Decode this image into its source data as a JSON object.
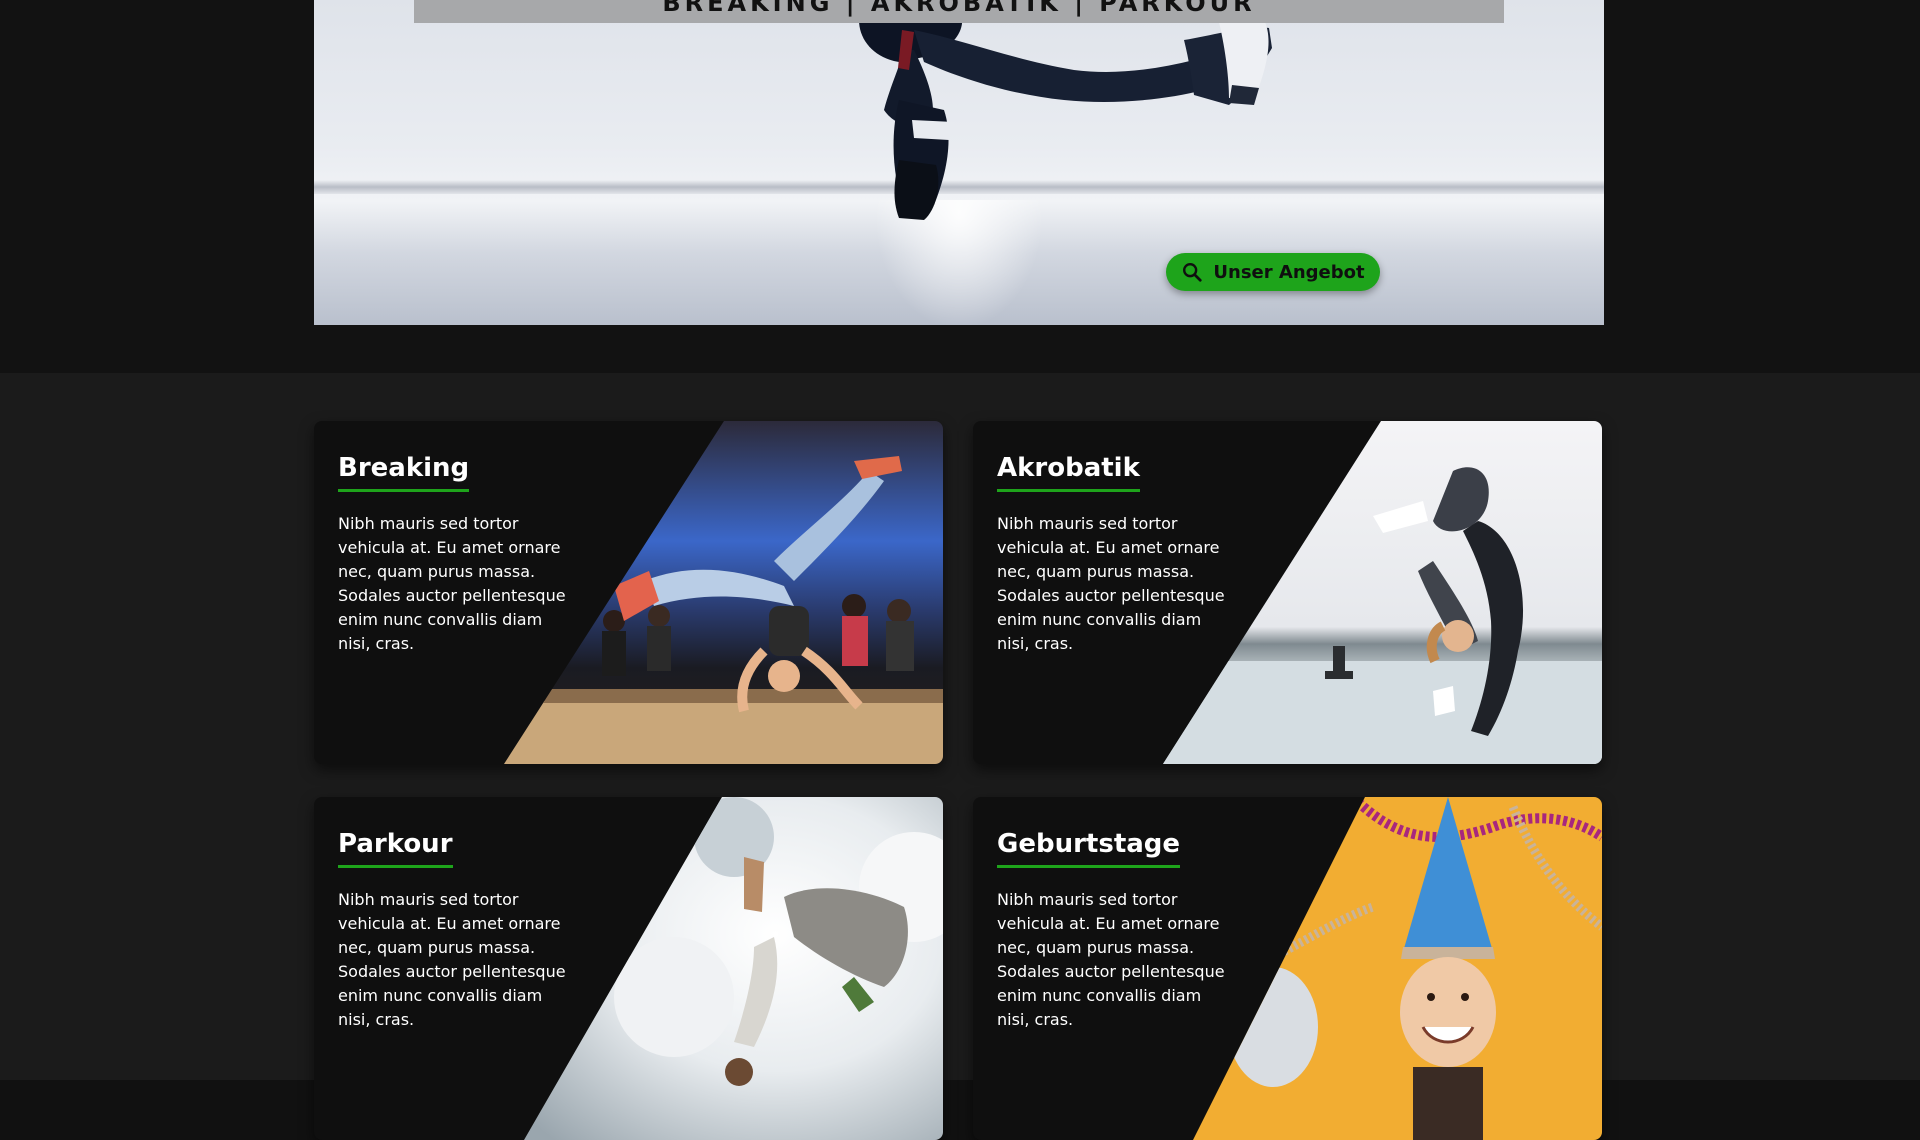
{
  "hero": {
    "banner_text": "BREAKING | AKROBATIK | PARKOUR",
    "cta_label": "Unser Angebot",
    "cta_icon": "search-icon"
  },
  "colors": {
    "accent": "#1ea41b",
    "background": "#121212",
    "section_background": "#1b1b1b",
    "card_background": "#0f0f0f"
  },
  "cards": [
    {
      "title": "Breaking",
      "text": "Nibh mauris sed tortor vehicula at. Eu amet ornare nec, quam purus massa. Sodales auctor pellentesque enim nunc convallis diam nisi, cras.",
      "image": "breakdancer-headspin-photo"
    },
    {
      "title": "Akrobatik",
      "text": "Nibh mauris sed tortor vehicula at. Eu amet ornare nec, quam purus massa. Sodales auctor pellentesque enim nunc convallis diam nisi, cras.",
      "image": "acrobat-backbend-photo"
    },
    {
      "title": "Parkour",
      "text": "Nibh mauris sed tortor vehicula at. Eu amet ornare nec, quam purus massa. Sodales auctor pellentesque enim nunc convallis diam nisi, cras.",
      "image": "parkour-backflip-photo"
    },
    {
      "title": "Geburtstage",
      "text": "Nibh mauris sed tortor vehicula at. Eu amet ornare nec, quam purus massa. Sodales auctor pellentesque enim nunc convallis diam nisi, cras.",
      "image": "birthday-child-party-hat-photo"
    }
  ]
}
